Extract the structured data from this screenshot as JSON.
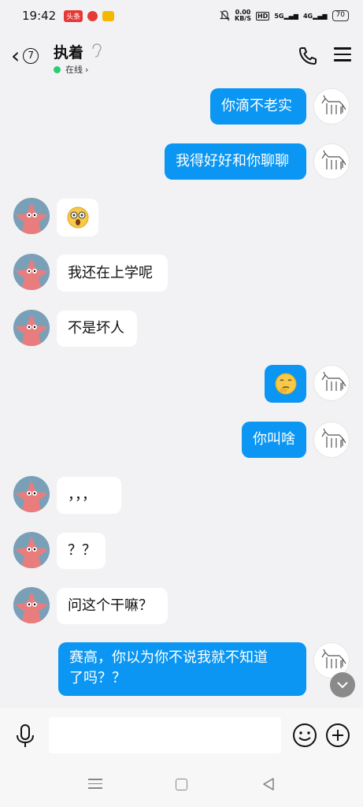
{
  "status_bar": {
    "time": "19:42",
    "badge_text": "头条",
    "net_speed_value": "0.00",
    "net_speed_unit": "KB/S",
    "hd_label": "HD",
    "signal1_label": "5G",
    "signal2_label": "4G",
    "battery": "70"
  },
  "header": {
    "unread_count": "7",
    "contact_name": "执着",
    "status_text": "在线",
    "status_chevron": "›",
    "online_color": "#2ecc71"
  },
  "messages": [
    {
      "sender": "me",
      "text": "你滴不老实"
    },
    {
      "sender": "me",
      "text": "我得好好和你聊聊"
    },
    {
      "sender": "them",
      "emoji": "astonished-face"
    },
    {
      "sender": "them",
      "text": "我还在上学呢"
    },
    {
      "sender": "them",
      "text": "不是坏人"
    },
    {
      "sender": "me",
      "emoji": "thinking-face"
    },
    {
      "sender": "me",
      "text": "你叫啥"
    },
    {
      "sender": "them",
      "text": "，，，"
    },
    {
      "sender": "them",
      "text": "？？"
    },
    {
      "sender": "them",
      "text": "问这个干嘛？"
    },
    {
      "sender": "me",
      "text_line1": "赛高，你以为你不说我就不知道",
      "text_line2": "了吗？？"
    }
  ],
  "input": {
    "placeholder": ""
  },
  "colors": {
    "my_bubble": "#0a96f2",
    "their_bubble": "#ffffff",
    "background": "#f2f2f4"
  }
}
